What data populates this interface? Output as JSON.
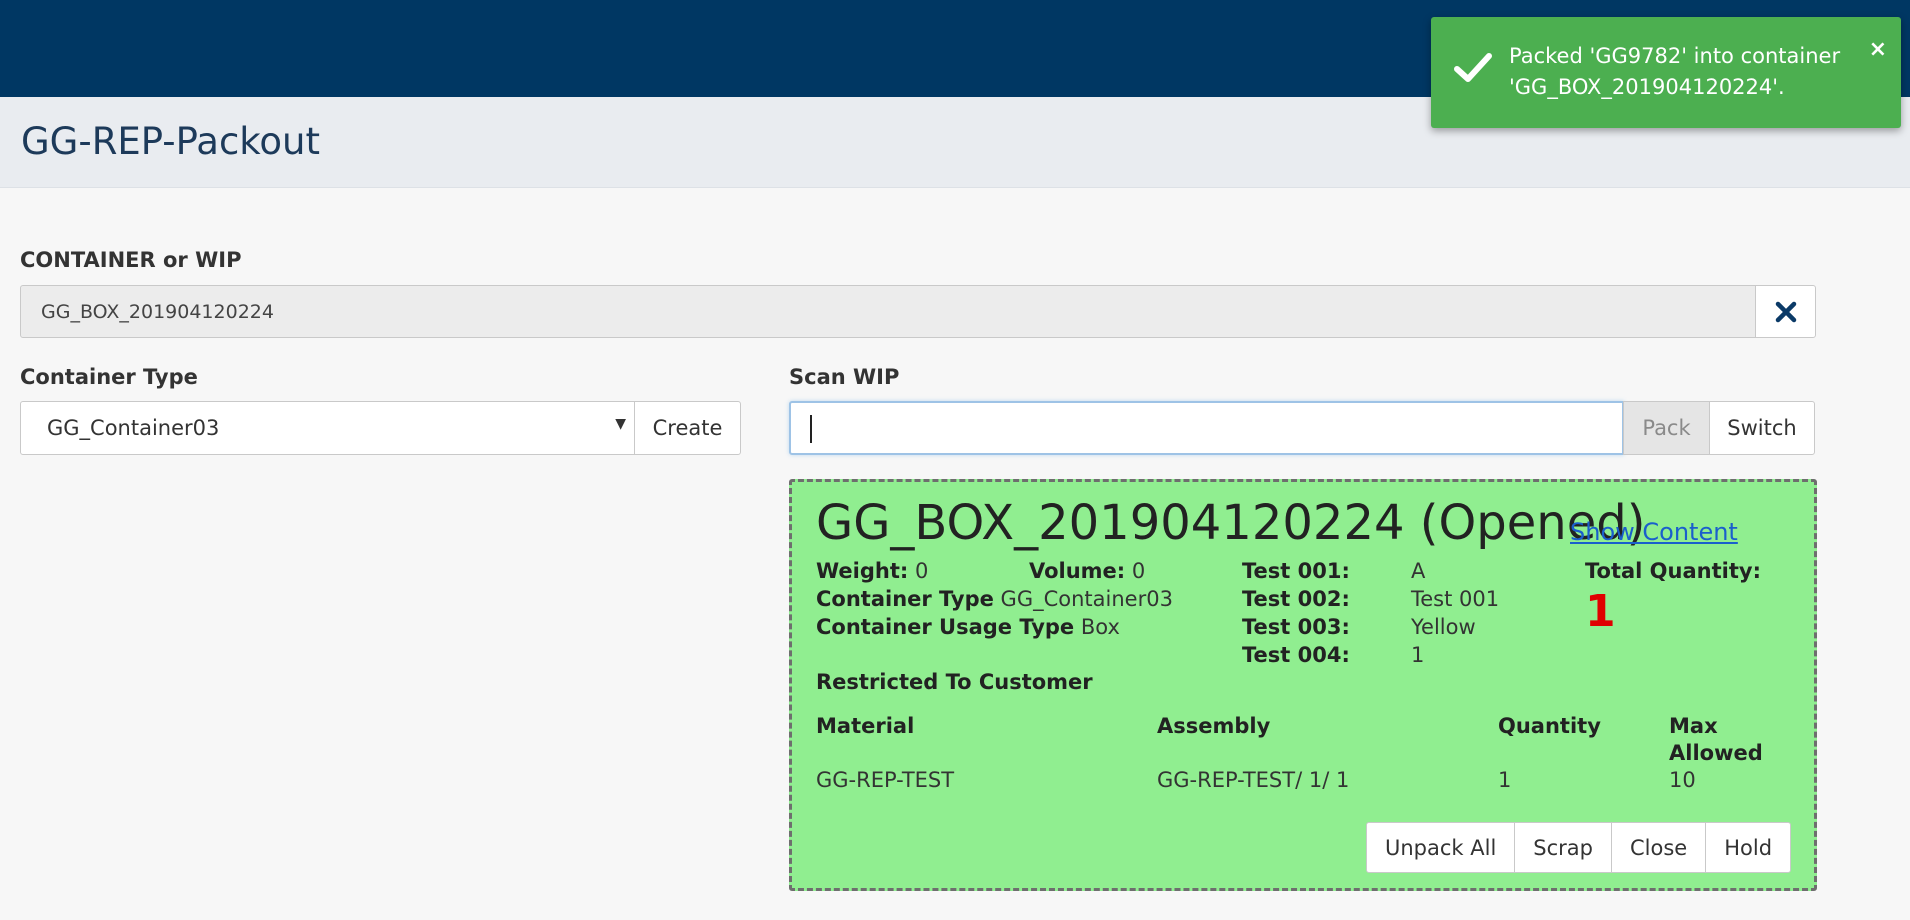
{
  "header": {
    "page_title": "GG-REP-Packout"
  },
  "container_field": {
    "label": "CONTAINER or WIP",
    "value": "GG_BOX_201904120224",
    "clear_icon": "close-icon"
  },
  "container_type": {
    "label": "Container Type",
    "selected": "GG_Container03",
    "create_label": "Create"
  },
  "scan": {
    "label": "Scan WIP",
    "value": "",
    "pack_label": "Pack",
    "switch_label": "Switch"
  },
  "container_panel": {
    "name": "GG_BOX_201904120224 (Opened)",
    "show_content": "Show Content",
    "background": "#90ee90",
    "weight_label": "Weight:",
    "weight_value": "0",
    "volume_label": "Volume:",
    "volume_value": "0",
    "container_type_label": "Container Type",
    "container_type_value": "GG_Container03",
    "usage_type_label": "Container Usage Type",
    "usage_type_value": "Box",
    "tests": [
      {
        "label": "Test 001:",
        "value": "A"
      },
      {
        "label": "Test 002:",
        "value": "Test 001"
      },
      {
        "label": "Test 003:",
        "value": "Yellow"
      },
      {
        "label": "Test 004:",
        "value": "1"
      }
    ],
    "total_quantity_label": "Total Quantity:",
    "total_quantity": "1",
    "restricted_label": "Restricted To Customer",
    "table": {
      "columns": [
        "Material",
        "Assembly",
        "Quantity",
        "Max Allowed"
      ],
      "rows": [
        [
          "GG-REP-TEST",
          "GG-REP-TEST/ 1/ 1",
          "1",
          "10"
        ]
      ]
    },
    "actions": [
      "Unpack All",
      "Scrap",
      "Close",
      "Hold"
    ]
  },
  "toast": {
    "message": "Packed 'GG9782' into container 'GG_BOX_201904120224'.",
    "close": "×",
    "icon": "check-icon",
    "color": "#4caf50"
  },
  "colors": {
    "topbar": "#003763",
    "title_bar": "#e9ecf0"
  }
}
